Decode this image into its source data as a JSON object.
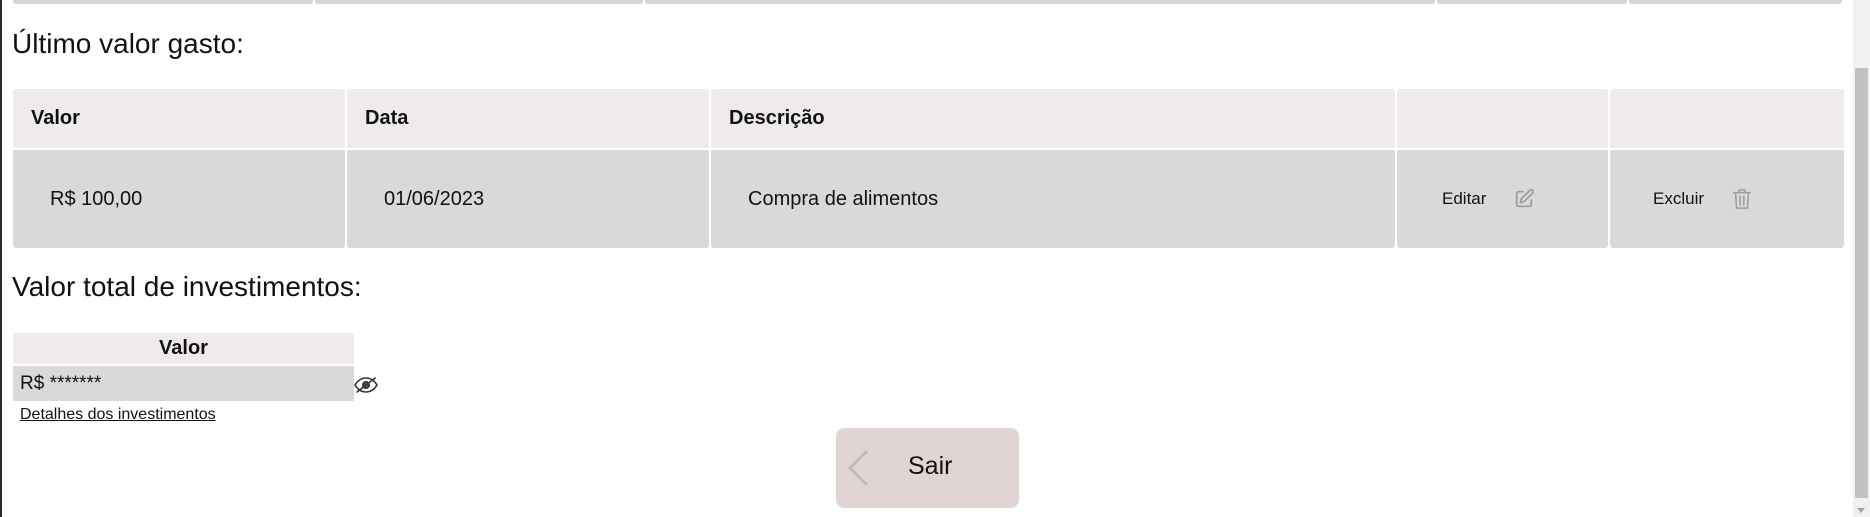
{
  "last_expense": {
    "title": "Último valor gasto:",
    "headers": {
      "valor": "Valor",
      "data": "Data",
      "descricao": "Descrição",
      "edit_col": "",
      "delete_col": ""
    },
    "row": {
      "valor": "R$ 100,00",
      "data": "01/06/2023",
      "descricao": "Compra de alimentos",
      "edit_label": "Editar",
      "delete_label": "Excluir"
    }
  },
  "investments": {
    "title": "Valor total de investimentos:",
    "header": "Valor",
    "value": "R$ *******",
    "details_link": "Detalhes dos investimentos"
  },
  "actions": {
    "exit_label": "Sair"
  },
  "icons": {
    "edit": "pencil-square-icon",
    "delete": "trash-icon",
    "toggle_visibility": "eye-slash-icon",
    "back": "chevron-left-icon"
  },
  "colors": {
    "header_bg": "#efebeb",
    "cell_bg": "#d9d9d9",
    "exit_button_bg": "#e0d4d4"
  }
}
